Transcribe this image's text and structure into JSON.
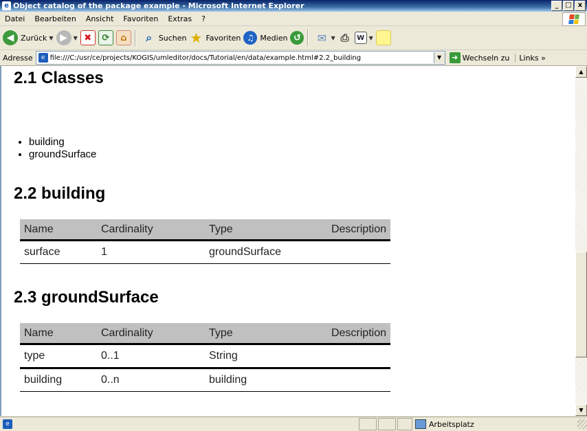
{
  "window": {
    "title": "Object catalog of the package example - Microsoft Internet Explorer",
    "buttons": {
      "minimize": "_",
      "maximize": "□",
      "close": "x"
    }
  },
  "menu": [
    "Datei",
    "Bearbeiten",
    "Ansicht",
    "Favoriten",
    "Extras",
    "?"
  ],
  "toolbar": {
    "back_label": "Zurück",
    "search_label": "Suchen",
    "favorites_label": "Favoriten",
    "media_label": "Medien"
  },
  "address_bar": {
    "label": "Adresse",
    "url": "file:///C:/usr/ce/projects/KOGIS/umleditor/docs/Tutorial/en/data/example.html#2.2_building",
    "go_label": "Wechseln zu",
    "links_label": "Links"
  },
  "content": {
    "section_classes": {
      "heading": "2.1 Classes",
      "items": [
        "building",
        "groundSurface"
      ]
    },
    "section_building": {
      "heading": "2.2 building",
      "columns": [
        "Name",
        "Cardinality",
        "Type",
        "Description"
      ],
      "rows": [
        {
          "name": "surface",
          "cardinality": "1",
          "type": "groundSurface",
          "description": ""
        }
      ]
    },
    "section_groundsurface": {
      "heading": "2.3 groundSurface",
      "columns": [
        "Name",
        "Cardinality",
        "Type",
        "Description"
      ],
      "rows": [
        {
          "name": "type",
          "cardinality": "0..1",
          "type": "String",
          "description": ""
        },
        {
          "name": "building",
          "cardinality": "0..n",
          "type": "building",
          "description": ""
        }
      ]
    }
  },
  "status_bar": {
    "zone": "Arbeitsplatz"
  }
}
